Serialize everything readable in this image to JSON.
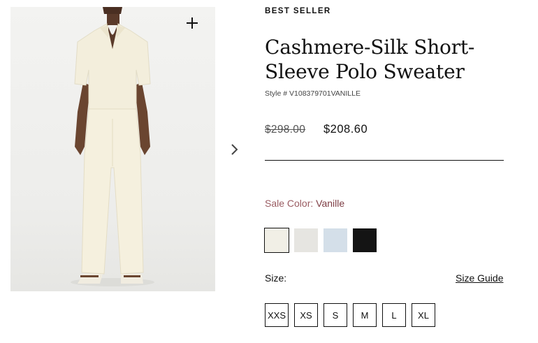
{
  "product": {
    "badge": "BEST SELLER",
    "title": "Cashmere-Silk Short-Sleeve Polo Sweater",
    "style_number": "Style # V108379701VANILLE",
    "original_price": "$298.00",
    "sale_price": "$208.60",
    "image_alt": "Model wearing a cream short-sleeve polo sweater and matching wide-leg pants"
  },
  "gallery": {
    "zoom_icon": "plus-icon",
    "next_icon": "chevron-right-icon"
  },
  "color": {
    "label": "Sale Color: ",
    "selected": "Vanille",
    "swatches": [
      {
        "color": "#f1efe6",
        "selected": true
      },
      {
        "color": "#e6e5e1",
        "selected": false
      },
      {
        "color": "#d4dfe9",
        "selected": false
      },
      {
        "color": "#141414",
        "selected": false
      }
    ]
  },
  "size": {
    "label": "Size:",
    "guide_label": "Size Guide",
    "options": [
      "XXS",
      "XS",
      "S",
      "M",
      "L",
      "XL"
    ]
  }
}
